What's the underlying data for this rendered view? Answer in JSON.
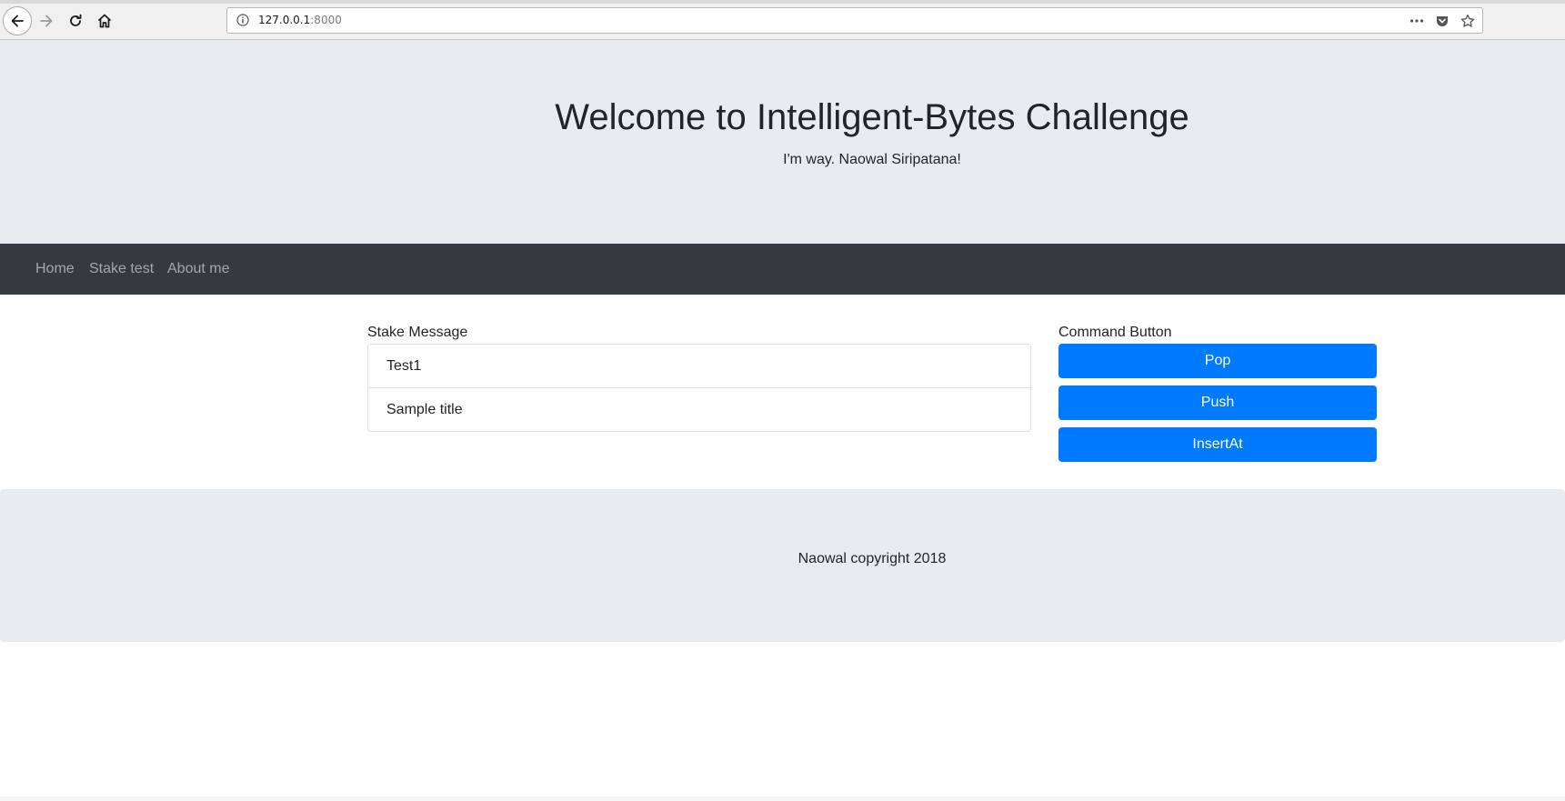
{
  "browser": {
    "url_host": "127.0.0.1",
    "url_port": ":8000",
    "icons": {
      "back": "back-arrow-icon",
      "forward": "forward-arrow-icon",
      "reload": "reload-icon",
      "home": "home-icon",
      "info": "info-icon",
      "more": "more-dots-icon",
      "pocket": "pocket-icon",
      "bookmark": "star-icon"
    }
  },
  "header": {
    "title": "Welcome to Intelligent-Bytes Challenge",
    "subtitle": "I'm way. Naowal Siripatana!"
  },
  "navbar": {
    "items": [
      {
        "label": "Home"
      },
      {
        "label": "Stake test"
      },
      {
        "label": "About me"
      }
    ]
  },
  "stake": {
    "label": "Stake Message",
    "items": [
      "Test1",
      "Sample title"
    ]
  },
  "commands": {
    "label": "Command Button",
    "buttons": [
      {
        "label": "Pop"
      },
      {
        "label": "Push"
      },
      {
        "label": "InsertAt"
      }
    ]
  },
  "footer": {
    "text": "Naowal copyright 2018"
  },
  "colors": {
    "primary": "#007bff",
    "navbar_bg": "#343a40",
    "jumbotron_bg": "#e9ecef"
  }
}
